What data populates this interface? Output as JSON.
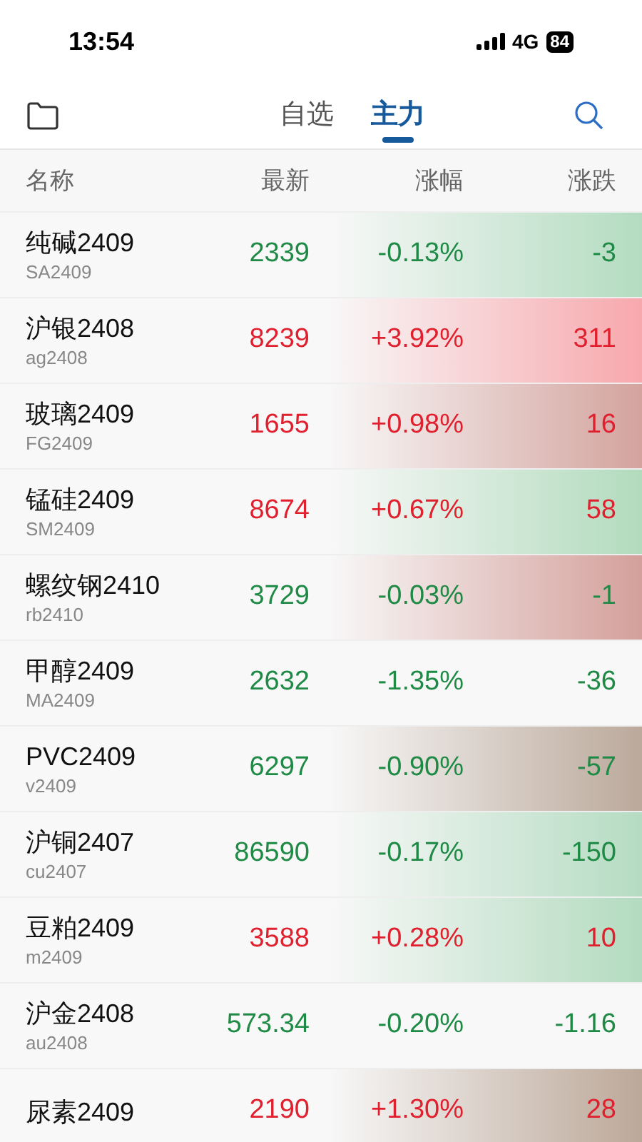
{
  "status_bar": {
    "time": "13:54",
    "network": "4G",
    "battery": "84"
  },
  "tabs": [
    {
      "label": "自选",
      "selected": false
    },
    {
      "label": "主力",
      "selected": true
    }
  ],
  "columns": [
    "名称",
    "最新",
    "涨幅",
    "涨跌"
  ],
  "rows": [
    {
      "name": "纯碱2409",
      "code": "SA2409",
      "price": "2339",
      "pct": "-0.13%",
      "change": "-3",
      "kind": "down",
      "color": "#b3dcc0"
    },
    {
      "name": "沪银2408",
      "code": "ag2408",
      "price": "8239",
      "pct": "+3.92%",
      "change": "311",
      "kind": "up",
      "color": "#f7a8ad"
    },
    {
      "name": "玻璃2409",
      "code": "FG2409",
      "price": "1655",
      "pct": "+0.98%",
      "change": "16",
      "kind": "up",
      "color": "#d4a39e"
    },
    {
      "name": "锰硅2409",
      "code": "SM2409",
      "price": "8674",
      "pct": "+0.67%",
      "change": "58",
      "kind": "up",
      "color": "#b2dbbd"
    },
    {
      "name": "螺纹钢2410",
      "code": "rb2410",
      "price": "3729",
      "pct": "-0.03%",
      "change": "-1",
      "kind": "down",
      "color": "#d4a09b"
    },
    {
      "name": "甲醇2409",
      "code": "MA2409",
      "price": "2632",
      "pct": "-1.35%",
      "change": "-36",
      "kind": "down"
    },
    {
      "name": "PVC2409",
      "code": "v2409",
      "price": "6297",
      "pct": "-0.90%",
      "change": "-57",
      "kind": "down",
      "color": "#bba99b"
    },
    {
      "name": "沪铜2407",
      "code": "cu2407",
      "price": "86590",
      "pct": "-0.17%",
      "change": "-150",
      "kind": "down",
      "color": "#b5dcc2"
    },
    {
      "name": "豆粕2409",
      "code": "m2409",
      "price": "3588",
      "pct": "+0.28%",
      "change": "10",
      "kind": "up",
      "color": "#b3dbbf"
    },
    {
      "name": "沪金2408",
      "code": "au2408",
      "price": "573.34",
      "pct": "-0.20%",
      "change": "-1.16",
      "kind": "down"
    },
    {
      "name": "尿素2409",
      "price": "2190",
      "pct": "+1.30%",
      "change": "28",
      "kind": "up",
      "color": "#bca899"
    }
  ]
}
